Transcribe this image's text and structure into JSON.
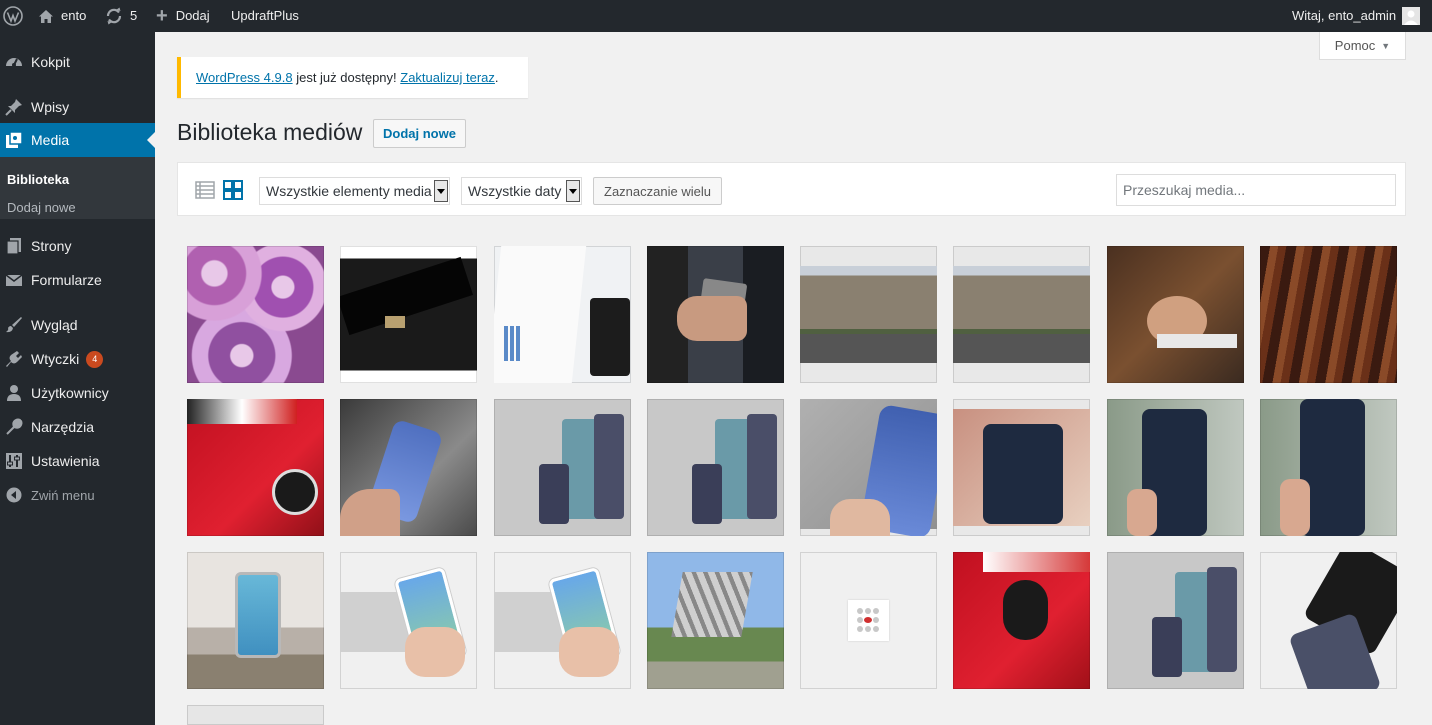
{
  "adminbar": {
    "site_name": "ento",
    "updates_count": "5",
    "new_label": "Dodaj",
    "plugin_label": "UpdraftPlus",
    "greeting": "Witaj, ento_admin"
  },
  "sidebar": {
    "items": [
      {
        "label": "Kokpit",
        "icon": "dashboard-icon"
      },
      {
        "label": "Wpisy",
        "icon": "pin-icon"
      },
      {
        "label": "Media",
        "icon": "media-icon"
      },
      {
        "label": "Strony",
        "icon": "pages-icon"
      },
      {
        "label": "Formularze",
        "icon": "mail-icon"
      },
      {
        "label": "Wygląd",
        "icon": "brush-icon"
      },
      {
        "label": "Wtyczki",
        "icon": "plugin-icon",
        "badge": "4"
      },
      {
        "label": "Użytkownicy",
        "icon": "user-icon"
      },
      {
        "label": "Narzędzia",
        "icon": "wrench-icon"
      },
      {
        "label": "Ustawienia",
        "icon": "settings-icon"
      },
      {
        "label": "Zwiń menu",
        "icon": "collapse-icon"
      }
    ],
    "submenu": [
      {
        "label": "Biblioteka"
      },
      {
        "label": "Dodaj nowe"
      }
    ]
  },
  "help_tab": {
    "label": "Pomoc"
  },
  "notice": {
    "link1": "WordPress 4.9.8",
    "text": " jest już dostępny! ",
    "link2": "Zaktualizuj teraz",
    "end": "."
  },
  "page": {
    "title": "Biblioteka mediów",
    "add_new": "Dodaj nowe"
  },
  "toolbar": {
    "filter_type": "Wszystkie elementy media",
    "filter_date": "Wszystkie daty",
    "bulk_select": "Zaznaczanie wielu",
    "search_placeholder": "Przeszukaj media..."
  },
  "colors": {
    "adminbar": "#23282d",
    "accent": "#0073aa",
    "notice_border": "#ffb900",
    "badge": "#ca4a1f"
  }
}
